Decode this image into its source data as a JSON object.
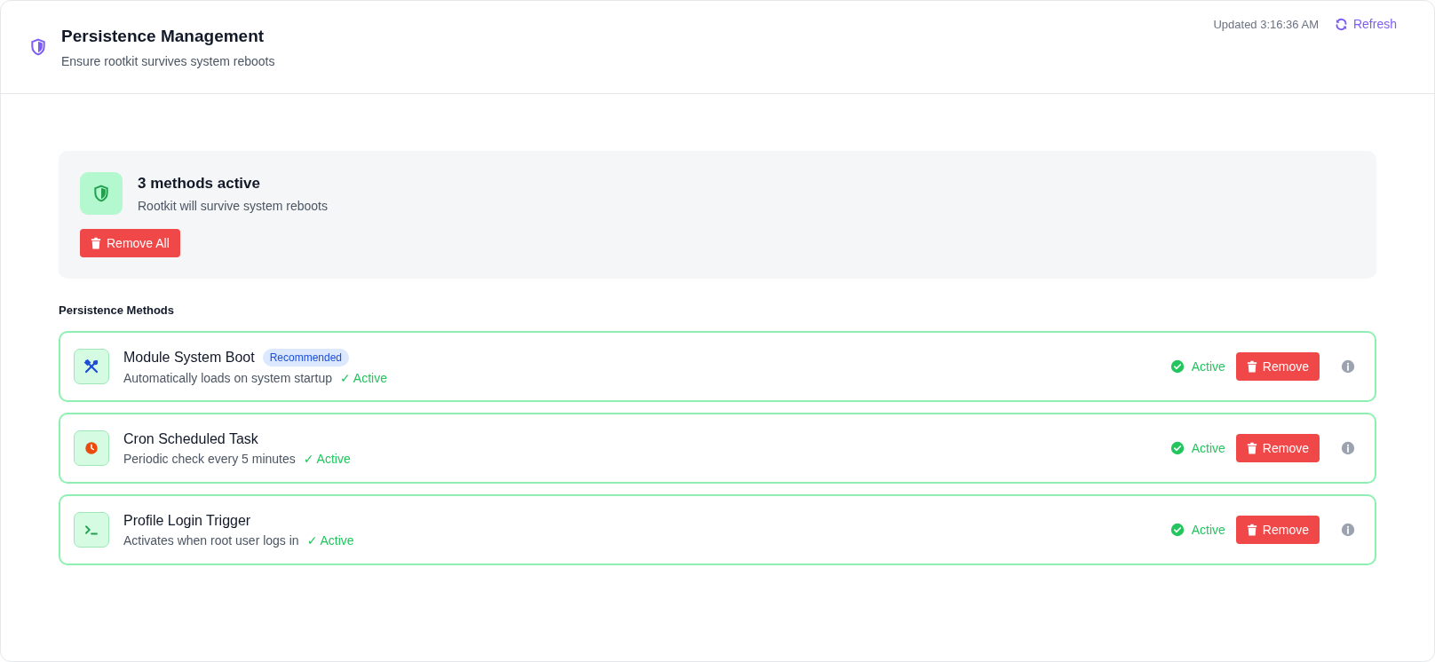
{
  "header": {
    "title": "Persistence Management",
    "subtitle": "Ensure rootkit survives system reboots",
    "updated": "Updated 3:16:36 AM",
    "refresh": "Refresh"
  },
  "summary": {
    "title": "3 methods active",
    "subtitle": "Rootkit will survive system reboots",
    "button": "Remove All"
  },
  "section_title": "Persistence Methods",
  "methods": [
    {
      "kind": "tools",
      "name": "Module System Boot",
      "badge": "Recommended",
      "description": "Automatically loads on system startup",
      "inline_status": "✓ Active",
      "status": "Active",
      "active": true,
      "button": "Remove"
    },
    {
      "kind": "clock",
      "name": "Cron Scheduled Task",
      "description": "Periodic check every 5 minutes",
      "inline_status": "✓ Active",
      "status": "Active",
      "active": true,
      "button": "Remove"
    },
    {
      "kind": "terminal",
      "name": "Profile Login Trigger",
      "description": "Activates when root user logs in",
      "inline_status": "✓ Active",
      "status": "Active",
      "active": true,
      "button": "Remove"
    }
  ]
}
